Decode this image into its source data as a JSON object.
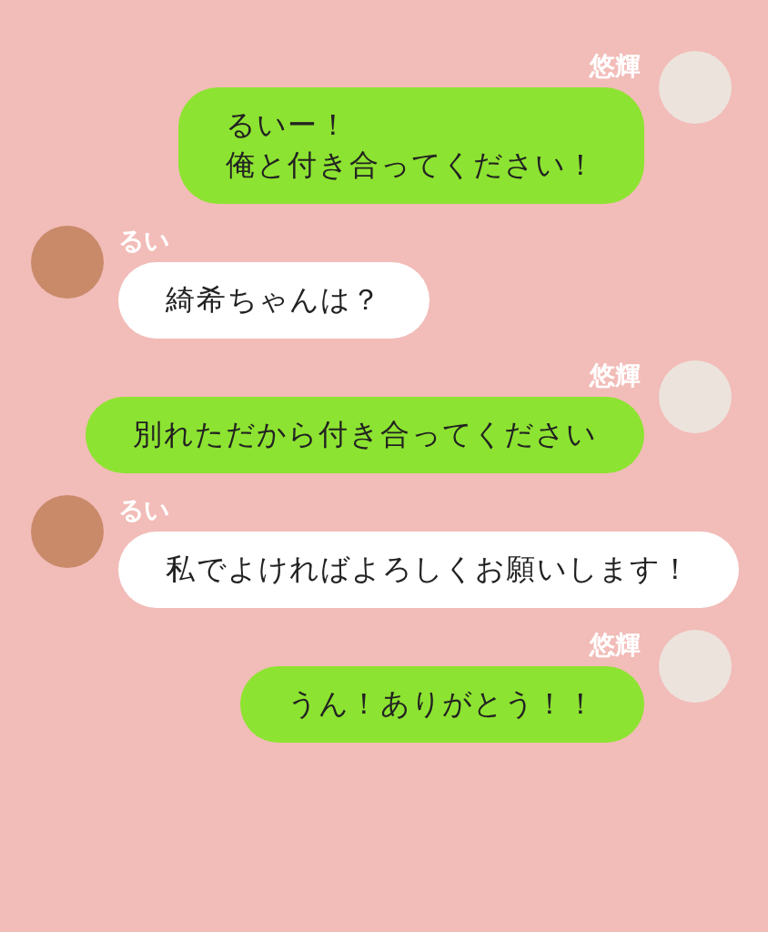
{
  "messages": [
    {
      "kind": "sent",
      "sender": "悠輝",
      "lines": [
        "るいー！",
        "俺と付き合ってください！"
      ]
    },
    {
      "kind": "received",
      "sender": "るい",
      "lines": [
        "綺希ちゃんは？"
      ]
    },
    {
      "kind": "sent",
      "sender": "悠輝",
      "lines": [
        "別れただから付き合ってください"
      ]
    },
    {
      "kind": "received",
      "sender": "るい",
      "lines": [
        "私でよければよろしくお願いします！"
      ]
    },
    {
      "kind": "sent",
      "sender": "悠輝",
      "lines": [
        "うん！ありがとう！！"
      ]
    }
  ]
}
